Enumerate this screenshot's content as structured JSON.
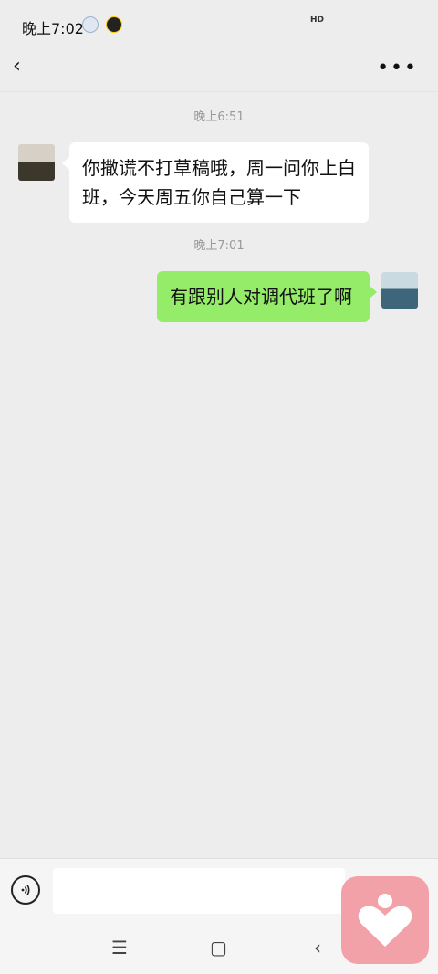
{
  "status": {
    "time": "晚上7:02",
    "network": "HD"
  },
  "topbar": {
    "back_icon": "‹",
    "more_icon": "•••"
  },
  "messages": [
    {
      "time": "晚上6:51",
      "side": "left",
      "text": "你撒谎不打草稿哦，周一问你上白班，今天周五你自己算一下"
    },
    {
      "time": "晚上7:01",
      "side": "right",
      "text": "有跟别人对调代班了啊"
    }
  ],
  "composer": {
    "voice_icon": "voice-icon",
    "input_value": ""
  },
  "nav": {
    "menu_icon": "☰",
    "home_icon": "▢",
    "back_icon": "‹"
  },
  "overlay": {
    "icon": "heart-person-icon",
    "color": "#f3a1a8"
  }
}
